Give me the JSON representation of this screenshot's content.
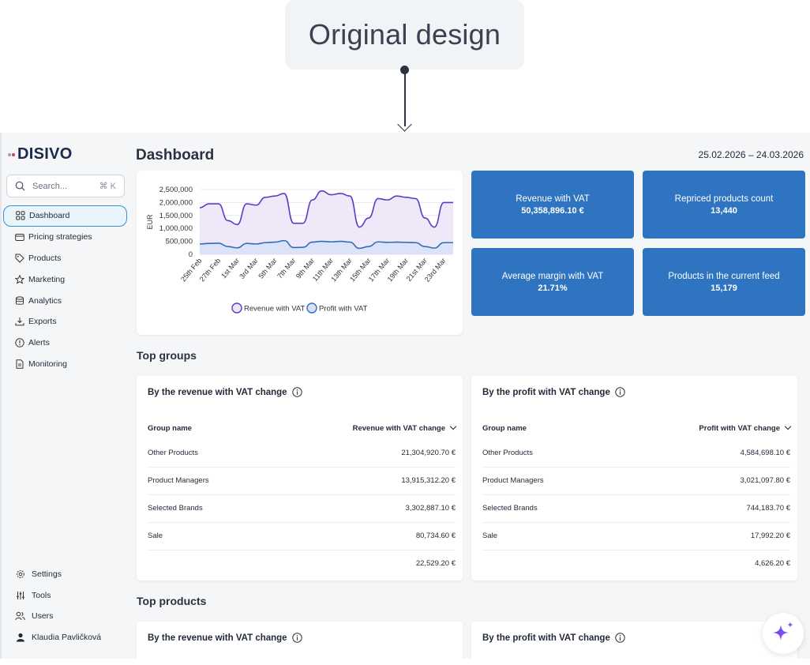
{
  "banner": {
    "label": "Original design"
  },
  "brand": {
    "name": "DISIVO",
    "accent": "#2f74c0"
  },
  "search": {
    "placeholder": "Search...",
    "shortcut": "⌘ K"
  },
  "sidebar": {
    "items": [
      {
        "label": "Dashboard",
        "icon": "grid-icon",
        "active": true
      },
      {
        "label": "Pricing strategies",
        "icon": "wallet-icon"
      },
      {
        "label": "Products",
        "icon": "tag-icon"
      },
      {
        "label": "Marketing",
        "icon": "star-icon"
      },
      {
        "label": "Analytics",
        "icon": "database-icon"
      },
      {
        "label": "Exports",
        "icon": "download-icon"
      },
      {
        "label": "Alerts",
        "icon": "alert-icon"
      },
      {
        "label": "Monitoring",
        "icon": "document-icon"
      }
    ],
    "bottom": [
      {
        "label": "Settings",
        "icon": "gear-icon"
      },
      {
        "label": "Tools",
        "icon": "sliders-icon"
      },
      {
        "label": "Users",
        "icon": "users-icon"
      },
      {
        "label": "Klaudia Pavličková",
        "icon": "user-icon"
      }
    ]
  },
  "header": {
    "title": "Dashboard",
    "date_range": "25.02.2026 – 24.03.2026"
  },
  "kpis": [
    {
      "label": "Revenue with VAT",
      "value": "50,358,896.10 €"
    },
    {
      "label": "Repriced products count",
      "value": "13,440"
    },
    {
      "label": "Average margin with VAT",
      "value": "21.71%"
    },
    {
      "label": "Products in the current feed",
      "value": "15,179"
    }
  ],
  "chart_data": {
    "type": "area",
    "ylabel": "EUR",
    "ylim": [
      0,
      2500000
    ],
    "yticks": [
      "2,500,000",
      "2,000,000",
      "1,500,000",
      "1,000,000",
      "500,000",
      "0"
    ],
    "xtick_labels": [
      "25th Feb",
      "27th Feb",
      "1st Mar",
      "3rd Mar",
      "5th Mar",
      "7th Mar",
      "9th Mar",
      "11th Mar",
      "13th Mar",
      "15th Mar",
      "17th Mar",
      "19th Mar",
      "21st Mar",
      "23rd Mar"
    ],
    "x": [
      "25th Feb",
      "26th Feb",
      "27th Feb",
      "28th Feb",
      "1st Mar",
      "2nd Mar",
      "3rd Mar",
      "4th Mar",
      "5th Mar",
      "6th Mar",
      "7th Mar",
      "8th Mar",
      "9th Mar",
      "10th Mar",
      "11th Mar",
      "12th Mar",
      "13th Mar",
      "14th Mar",
      "15th Mar",
      "16th Mar",
      "17th Mar",
      "18th Mar",
      "19th Mar",
      "20th Mar",
      "21st Mar",
      "22nd Mar",
      "23rd Mar",
      "24th Mar"
    ],
    "series": [
      {
        "name": "Revenue with VAT",
        "color": "#5b3cc4",
        "fill": "#ece6f8",
        "values": [
          1800000,
          1950000,
          1950000,
          1300000,
          1150000,
          1950000,
          1900000,
          2200000,
          2250000,
          2350000,
          1200000,
          1200000,
          2100000,
          2450000,
          2300000,
          2350000,
          2250000,
          1050000,
          1400000,
          2150000,
          2100000,
          2250000,
          2200000,
          2150000,
          1400000,
          1050000,
          2000000,
          2000000
        ]
      },
      {
        "name": "Profit with VAT",
        "color": "#2f6fb8",
        "fill": "#d9e1f6",
        "values": [
          400000,
          420000,
          430000,
          300000,
          250000,
          420000,
          400000,
          450000,
          470000,
          530000,
          260000,
          270000,
          470000,
          500000,
          480000,
          500000,
          470000,
          230000,
          300000,
          480000,
          460000,
          470000,
          460000,
          450000,
          300000,
          240000,
          450000,
          450000
        ]
      }
    ],
    "legend": "bottom"
  },
  "sections": {
    "top_groups": "Top groups",
    "top_products": "Top products"
  },
  "tables": [
    {
      "title": "By the revenue with VAT change",
      "col_name": "Group name",
      "col_value": "Revenue with VAT change",
      "rows": [
        {
          "name": "Other Products",
          "value": "21,304,920.70 €"
        },
        {
          "name": "Product Managers",
          "value": "13,915,312.20 €"
        },
        {
          "name": "Selected Brands",
          "value": "3,302,887.10 €"
        },
        {
          "name": "Sale",
          "value": "80,734.60 €"
        },
        {
          "name": "",
          "value": "22,529.20 €"
        }
      ]
    },
    {
      "title": "By the profit with VAT change",
      "col_name": "Group name",
      "col_value": "Profit with VAT change",
      "rows": [
        {
          "name": "Other Products",
          "value": "4,584,698.10 €"
        },
        {
          "name": "Product Managers",
          "value": "3,021,097.80 €"
        },
        {
          "name": "Selected Brands",
          "value": "744,183.70 €"
        },
        {
          "name": "Sale",
          "value": "17,992.20 €"
        },
        {
          "name": "",
          "value": "4,626.20 €"
        }
      ]
    }
  ],
  "products_cards": [
    {
      "title": "By the revenue with VAT change"
    },
    {
      "title": "By the profit with VAT change"
    }
  ]
}
